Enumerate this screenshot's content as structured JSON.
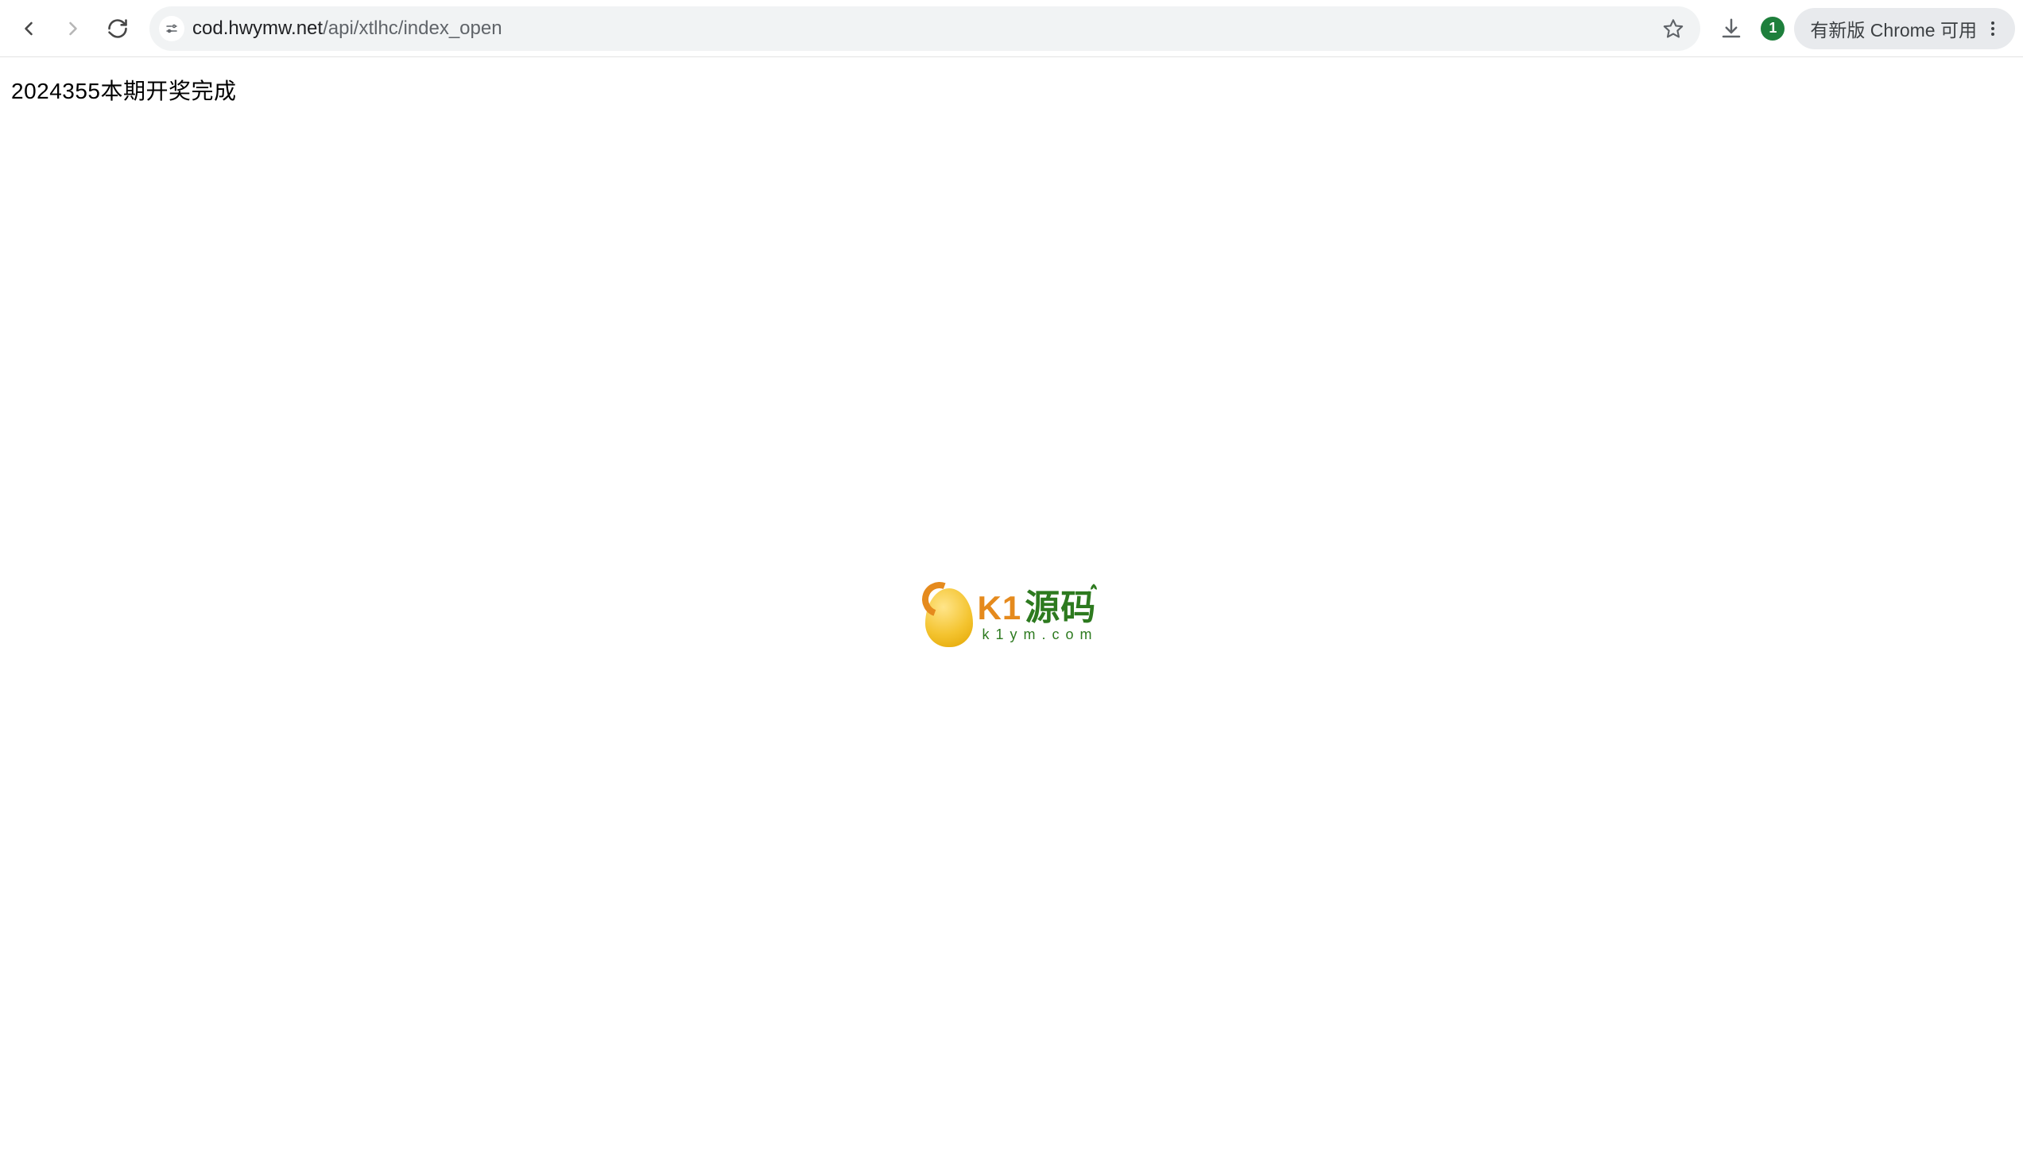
{
  "toolbar": {
    "url_host": "cod.hwymw.net",
    "url_path": "/api/xtlhc/index_open",
    "profile_badge": "1",
    "update_label": "有新版 Chrome 可用"
  },
  "page": {
    "body_text": "2024355本期开奖完成"
  },
  "watermark": {
    "brand_left": "K1",
    "brand_right": "源码",
    "domain": "k1ym.com"
  }
}
